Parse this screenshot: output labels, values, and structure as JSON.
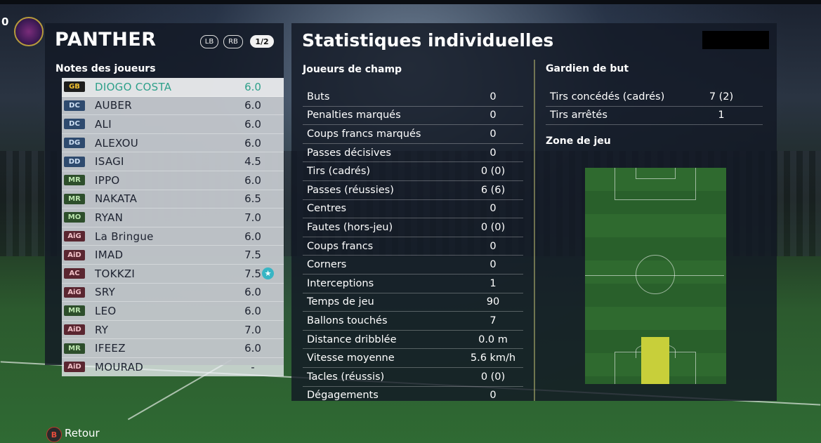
{
  "header": {
    "score_fragment": "0"
  },
  "team": {
    "name": "PANTHER",
    "lb": "LB",
    "rb": "RB",
    "page": "1/2"
  },
  "ratings_title": "Notes des joueurs",
  "players": [
    {
      "pos": "GB",
      "name": "DIOGO COSTA",
      "rating": "6.0"
    },
    {
      "pos": "DC",
      "name": "AUBER",
      "rating": "6.0"
    },
    {
      "pos": "DC",
      "name": "ALI",
      "rating": "6.0"
    },
    {
      "pos": "DG",
      "name": "ALEXOU",
      "rating": "6.0"
    },
    {
      "pos": "DD",
      "name": "ISAGI",
      "rating": "4.5"
    },
    {
      "pos": "MR",
      "name": "IPPO",
      "rating": "6.0"
    },
    {
      "pos": "MR",
      "name": "NAKATA",
      "rating": "6.5"
    },
    {
      "pos": "MO",
      "name": "RYAN",
      "rating": "7.0"
    },
    {
      "pos": "AiG",
      "name": "La Bringue",
      "rating": "6.0"
    },
    {
      "pos": "AiD",
      "name": "IMAD",
      "rating": "7.5"
    },
    {
      "pos": "AC",
      "name": "TOKKZI",
      "rating": "7.5"
    },
    {
      "pos": "AiG",
      "name": "SRY",
      "rating": "6.0"
    },
    {
      "pos": "MR",
      "name": "LEO",
      "rating": "6.0"
    },
    {
      "pos": "AiD",
      "name": "RY",
      "rating": "7.0"
    },
    {
      "pos": "MR",
      "name": "IFEEZ",
      "rating": "6.0"
    },
    {
      "pos": "AiD",
      "name": "MOURAD",
      "rating": "-"
    }
  ],
  "stats_title": "Statistiques individuelles",
  "field_title": "Joueurs de champ",
  "field_stats": [
    {
      "label": "Buts",
      "value": "0"
    },
    {
      "label": "Penalties marqués",
      "value": "0"
    },
    {
      "label": "Coups francs marqués",
      "value": "0"
    },
    {
      "label": "Passes décisives",
      "value": "0"
    },
    {
      "label": "Tirs (cadrés)",
      "value": "0 (0)"
    },
    {
      "label": "Passes (réussies)",
      "value": "6 (6)"
    },
    {
      "label": "Centres",
      "value": "0"
    },
    {
      "label": "Fautes (hors-jeu)",
      "value": "0 (0)"
    },
    {
      "label": "Coups francs",
      "value": "0"
    },
    {
      "label": "Corners",
      "value": "0"
    },
    {
      "label": "Interceptions",
      "value": "1"
    },
    {
      "label": "Temps de jeu",
      "value": "90"
    },
    {
      "label": "Ballons touchés",
      "value": "7"
    },
    {
      "label": "Distance dribblée",
      "value": "0.0 m"
    },
    {
      "label": "Vitesse moyenne",
      "value": "5.6 km/h"
    },
    {
      "label": "Tacles (réussis)",
      "value": "0 (0)"
    },
    {
      "label": "Dégagements",
      "value": "0"
    }
  ],
  "gk_title": "Gardien de but",
  "gk_stats": [
    {
      "label": "Tirs concédés (cadrés)",
      "value": "7 (2)"
    },
    {
      "label": "Tirs arrêtés",
      "value": "1"
    }
  ],
  "zone_title": "Zone de jeu",
  "footer": {
    "button": "B",
    "label": "Retour"
  },
  "colors": {
    "selected_player": "#2ea08a",
    "heat_zone": "#c8cf3a",
    "star_badge": "#38b5c4"
  }
}
